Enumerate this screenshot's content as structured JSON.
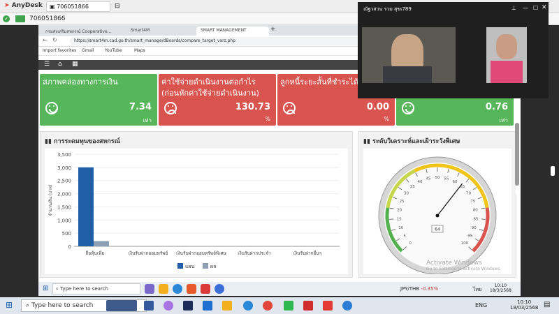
{
  "anydesk": {
    "app_name": "AnyDesk",
    "tab1_label": "706051866",
    "tab2_label": "706051866",
    "address_value": "706051866"
  },
  "browser": {
    "tabs": [
      {
        "label": "กรมส่งเสริมสหกรณ์ Cooperative..."
      },
      {
        "label": "Smart4M"
      },
      {
        "label": "SMART MANAGEMENT"
      }
    ],
    "url": "https://smart4m.cad.go.th/smart_manage/dBoards/compare_target_varz.php",
    "bookmarks": [
      {
        "label": "Import favorites"
      },
      {
        "label": "Gmail"
      },
      {
        "label": "YouTube"
      },
      {
        "label": "Maps"
      }
    ]
  },
  "cards": [
    {
      "title": "สภาพคล่องทางการเงิน",
      "value": "7.34",
      "unit": "เท่า",
      "status": "good",
      "color": "#57b55a"
    },
    {
      "title": "ค่าใช้จ่ายดำเนินงานต่อกำไร (ก่อนหักค่าใช้จ่ายดำเนินงาน)",
      "value": "130.73",
      "unit": "%",
      "status": "bad",
      "color": "#d9534f"
    },
    {
      "title": "ลูกหนี้ระยะสั้นที่ชำระได้ต",
      "value": "0.00",
      "unit": "%",
      "status": "bad",
      "color": "#d9534f"
    },
    {
      "title": "",
      "value": "0.76",
      "unit": "เท่า",
      "status": "good",
      "color": "#57b55a"
    }
  ],
  "panel_left_title": "การระดมทุนของสหกรณ์",
  "panel_right_title": "ระดับวิเคราะห์และเฝ้าระวังพิเศษ",
  "chart_data": {
    "type": "bar",
    "categories": [
      "ถือหุ้นเพิ่ม",
      "เงินรับฝากออมทรัพย์",
      "เงินรับฝากออมทรัพย์พิเศษ",
      "เงินรับฝากประจำ",
      "เงินรับฝากอื่นๆ"
    ],
    "series": [
      {
        "name": "แผน",
        "values": [
          3000,
          0,
          0,
          0,
          0
        ],
        "color": "#1f5fa8"
      },
      {
        "name": "ผล",
        "values": [
          200,
          0,
          0,
          0,
          0
        ],
        "color": "#8da0b3"
      }
    ],
    "ylabel": "จำนวนเงิน (บาท)",
    "yticks": [
      "0",
      "500",
      "1,000",
      "1,500",
      "2,000",
      "2,500",
      "3,000",
      "3,500"
    ],
    "ylim": [
      0,
      3500
    ]
  },
  "gauge": {
    "value": 64,
    "value_label": "64",
    "ticks": [
      "0",
      "5",
      "10",
      "15",
      "20",
      "25",
      "30",
      "35",
      "40",
      "45",
      "50",
      "55",
      "60",
      "65",
      "70",
      "75",
      "80",
      "85",
      "90",
      "95",
      "100"
    ],
    "min": 0,
    "max": 100
  },
  "teams": {
    "title": "ณัฐวสวน รวม สุขเ789"
  },
  "watermark": {
    "line1": "Activate Windows",
    "line2": "Go to Settings to activate Windows."
  },
  "remote_taskbar": {
    "search_placeholder": "Type here to search",
    "currency": "JPY/THB",
    "change": "-0.35%",
    "lang": "ไทย",
    "time": "10:10",
    "date": "18/3/2568"
  },
  "local_taskbar": {
    "search_placeholder": "Type here to search",
    "lang": "ENG",
    "time": "10:10",
    "date": "18/03/2568"
  }
}
